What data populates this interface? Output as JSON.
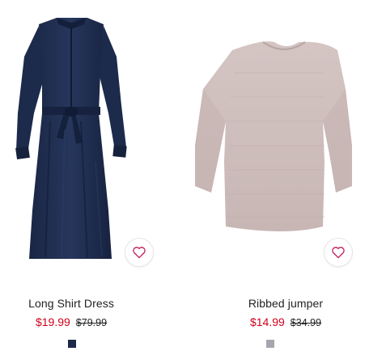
{
  "products": [
    {
      "name": "Long Shirt Dress",
      "sale_price": "$19.99",
      "original_price": "$79.99",
      "swatch_color": "#1e2a48",
      "garment_color": "#1f2f50",
      "icon": "heart-icon"
    },
    {
      "name": "Ribbed jumper",
      "sale_price": "$14.99",
      "original_price": "$34.99",
      "swatch_color": "#a9a5ad",
      "garment_color": "#cdbcba",
      "icon": "heart-icon"
    }
  ]
}
